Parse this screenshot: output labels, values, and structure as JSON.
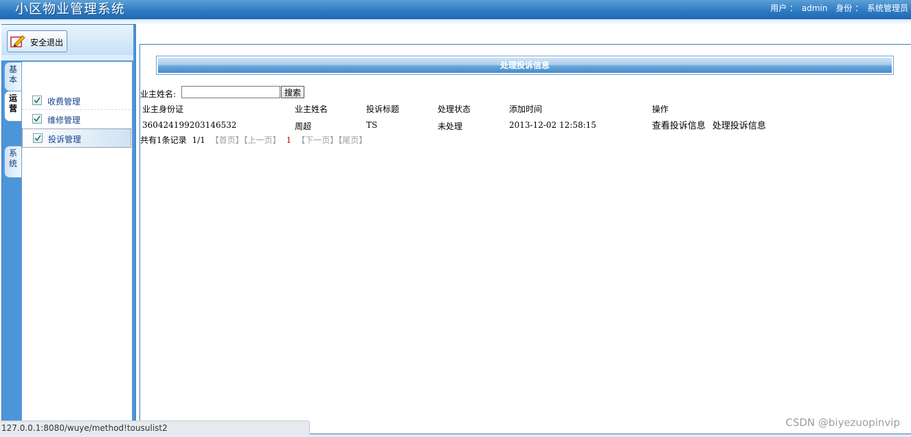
{
  "header": {
    "title": "小区物业管理系统",
    "user_label": "用户 ：",
    "user_name": "admin",
    "role_label": "身份 ：",
    "role_name": "系统管理员"
  },
  "sidebar": {
    "logout_label": "安全退出",
    "tabs": [
      {
        "chars": [
          "基",
          "本"
        ]
      },
      {
        "chars": [
          "运",
          "营"
        ],
        "active": true
      },
      {
        "chars": [
          "系",
          "统"
        ]
      }
    ],
    "menu_items": [
      {
        "label": "收费管理"
      },
      {
        "label": "维修管理"
      },
      {
        "label": "投诉管理",
        "selected": true
      }
    ]
  },
  "main": {
    "section_title": "处理投诉信息",
    "search": {
      "label": "业主姓名:",
      "value": "",
      "placeholder": "",
      "button_label": "搜索"
    },
    "table": {
      "headers": [
        "业主身份证",
        "业主姓名",
        "投诉标题",
        "处理状态",
        "添加时间",
        "操作"
      ],
      "rows": [
        {
          "id_card": "360424199203146532",
          "owner_name": "周超",
          "complaint_title": "TS",
          "status": "未处理",
          "added_time": "2013-12-02 12:58:15",
          "actions": [
            "查看投诉信息",
            "处理投诉信息"
          ]
        }
      ]
    },
    "pager": {
      "summary": "共有1条记录",
      "page_info": "1/1",
      "first": "【首页】",
      "prev": "【上一页】",
      "current": "1",
      "next": "【下一页】",
      "last": "【尾页】"
    }
  },
  "statusbar": {
    "url": "127.0.0.1:8080/wuye/method!tousulist2"
  },
  "watermark": "CSDN @biyezuopinvip",
  "colors": {
    "header_blue": "#2f7cc4",
    "sidebar_blue": "#4c95d9",
    "menu_text": "#15428b",
    "pager_current": "#cc0000"
  },
  "icons": {
    "logout": "logout-pencil-icon",
    "menu_item": "checkbox-checked-icon"
  }
}
